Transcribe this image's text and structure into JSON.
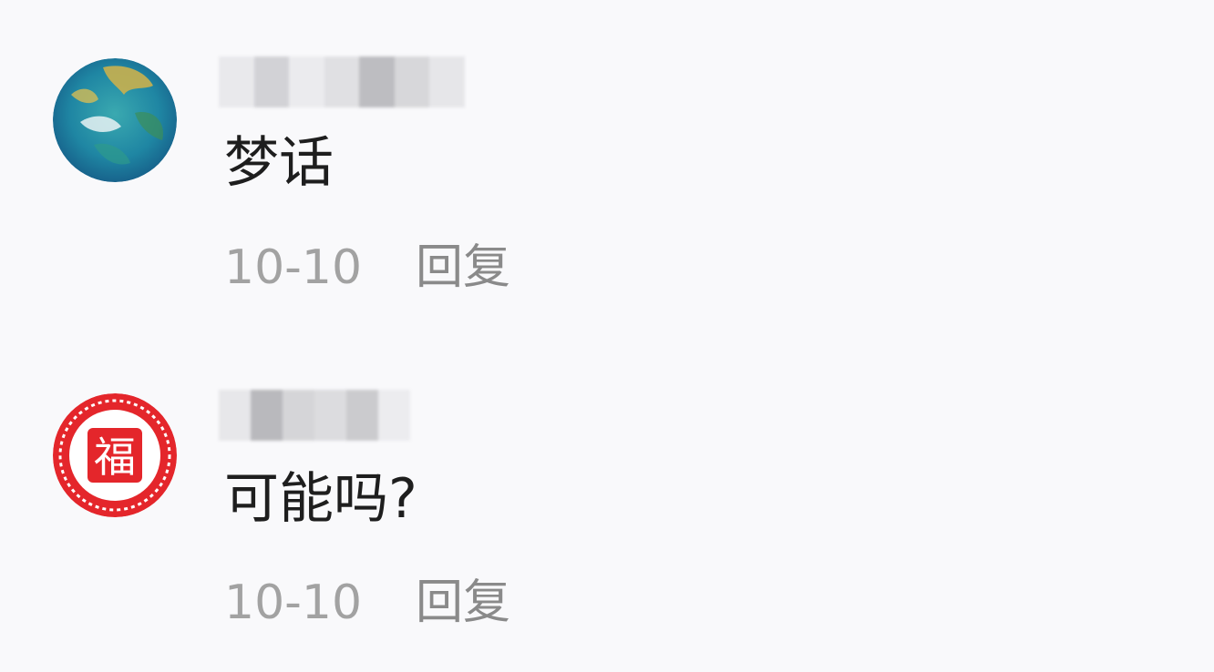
{
  "comments": [
    {
      "avatar": {
        "icon": "globe-avatar-icon",
        "colors": [
          "#1d7f9a",
          "#2fa6b8",
          "#d1b24a",
          "#175c8c"
        ]
      },
      "username_blurred": true,
      "text": "梦话",
      "date": "10-10",
      "reply_label": "回复"
    },
    {
      "avatar": {
        "icon": "fu-character-avatar-icon",
        "colors": [
          "#e4262b",
          "#ffffff"
        ]
      },
      "username_blurred": true,
      "text": "可能吗?",
      "date": "10-10",
      "reply_label": "回复"
    }
  ]
}
